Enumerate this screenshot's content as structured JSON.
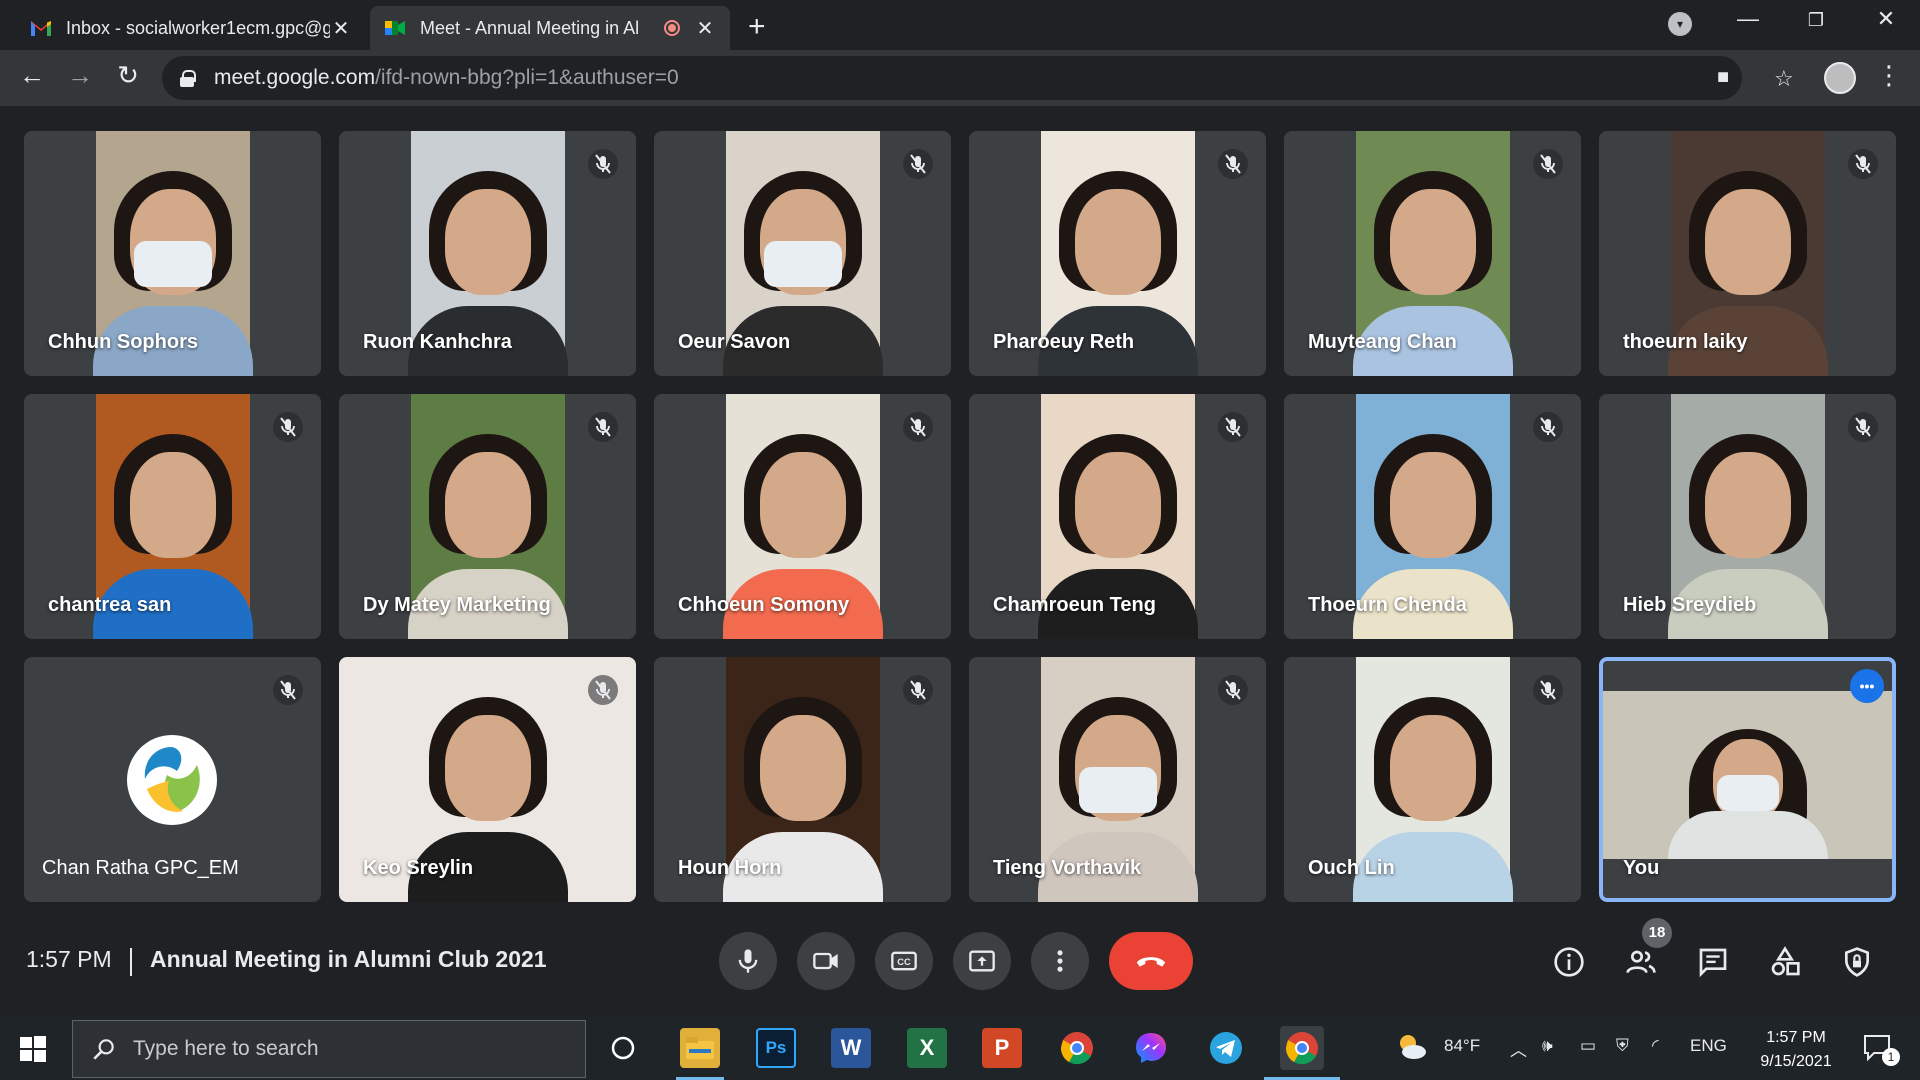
{
  "browser": {
    "tabs": [
      {
        "title": "Inbox - socialworker1ecm.gpc@g",
        "favicon": "gmail-icon",
        "active": false
      },
      {
        "title": "Meet - Annual Meeting in Al",
        "favicon": "meet-icon",
        "active": true,
        "recording": true
      }
    ],
    "new_tab_glyph": "+",
    "url_host": "meet.google.com",
    "url_path": "/ifd-nown-bbg?pli=1&authuser=0"
  },
  "participants": [
    {
      "name": "Chhun Sophors",
      "muted": false,
      "bg": "#b4a58f",
      "shirt": "#8ba7c7",
      "mask": true
    },
    {
      "name": "Ruon Kanhchra",
      "muted": true,
      "bg": "#c9cfd2",
      "shirt": "#2a2d2f",
      "mask": false
    },
    {
      "name": "Oeur Savon",
      "muted": true,
      "bg": "#d9d3c9",
      "shirt": "#2b2b2b",
      "mask": true
    },
    {
      "name": "Pharoeuy Reth",
      "muted": true,
      "bg": "#ece6dc",
      "shirt": "#2e3338",
      "mask": false
    },
    {
      "name": "Muyteang Chan",
      "muted": true,
      "bg": "#6f8a52",
      "shirt": "#a9c3e0",
      "mask": false
    },
    {
      "name": "thoeurn laiky",
      "muted": true,
      "bg": "#4a3a33",
      "shirt": "#5a4237",
      "mask": false
    },
    {
      "name": "chantrea san",
      "muted": true,
      "bg": "#b05a22",
      "shirt": "#1f6fc6",
      "mask": false
    },
    {
      "name": "Dy Matey Marketing",
      "muted": true,
      "bg": "#5e7d44",
      "shirt": "#d7d2c6",
      "mask": false
    },
    {
      "name": "Chhoeun Somony",
      "muted": true,
      "bg": "#e6e1d7",
      "shirt": "#f26b4f",
      "mask": false
    },
    {
      "name": "Chamroeun Teng",
      "muted": true,
      "bg": "#e9d8c6",
      "shirt": "#1e1e1e",
      "mask": false
    },
    {
      "name": "Thoeurn Chenda",
      "muted": true,
      "bg": "#7fb0d6",
      "shirt": "#ebe3c9",
      "mask": false
    },
    {
      "name": "Hieb Sreydieb",
      "muted": true,
      "bg": "#a5aba6",
      "shirt": "#c9cdbf",
      "mask": false
    },
    {
      "name": "Chan Ratha GPC_EM",
      "muted": true,
      "avatar_logo": true
    },
    {
      "name": "Keo Sreylin",
      "muted": true,
      "bg": "#ece7e2",
      "shirt": "#1d1d1d",
      "mask": false,
      "full": true
    },
    {
      "name": "Houn Horn",
      "muted": true,
      "bg": "#3b2418",
      "shirt": "#e9e9e9",
      "mask": false
    },
    {
      "name": "Tieng Vorthavik",
      "muted": true,
      "bg": "#d8cfc4",
      "shirt": "#cfc6bd",
      "mask": true
    },
    {
      "name": "Ouch Lin",
      "muted": true,
      "bg": "#e4e6e0",
      "shirt": "#b9d3e6",
      "mask": false
    },
    {
      "name": "You",
      "muted": false,
      "is_self": true,
      "bg": "#c9c5b9",
      "shirt": "#dfe4e3",
      "mask": true
    }
  ],
  "meeting": {
    "time": "1:57 PM",
    "title": "Annual Meeting in Alumni Club 2021",
    "participant_count": "18"
  },
  "controls": {
    "center": [
      "mic-icon",
      "camera-icon",
      "captions-icon",
      "present-icon",
      "more-options-icon",
      "end-call-icon"
    ],
    "right": [
      "info-icon",
      "people-icon",
      "chat-icon",
      "activities-icon",
      "host-controls-icon"
    ]
  },
  "taskbar": {
    "search_placeholder": "Type here to search",
    "apps": [
      "cortana-icon",
      "file-explorer-icon",
      "photoshop-icon",
      "word-icon",
      "excel-icon",
      "powerpoint-icon",
      "chrome-icon",
      "messenger-icon",
      "telegram-icon",
      "chrome-active-icon"
    ],
    "weather": "84°F",
    "language": "ENG",
    "time": "1:57 PM",
    "date": "9/15/2021",
    "notification_count": "1"
  },
  "colors": {
    "meet_bg": "#202124",
    "tile_bg": "#3c4043",
    "end_call": "#ea4335",
    "accent": "#8ab4f8"
  }
}
